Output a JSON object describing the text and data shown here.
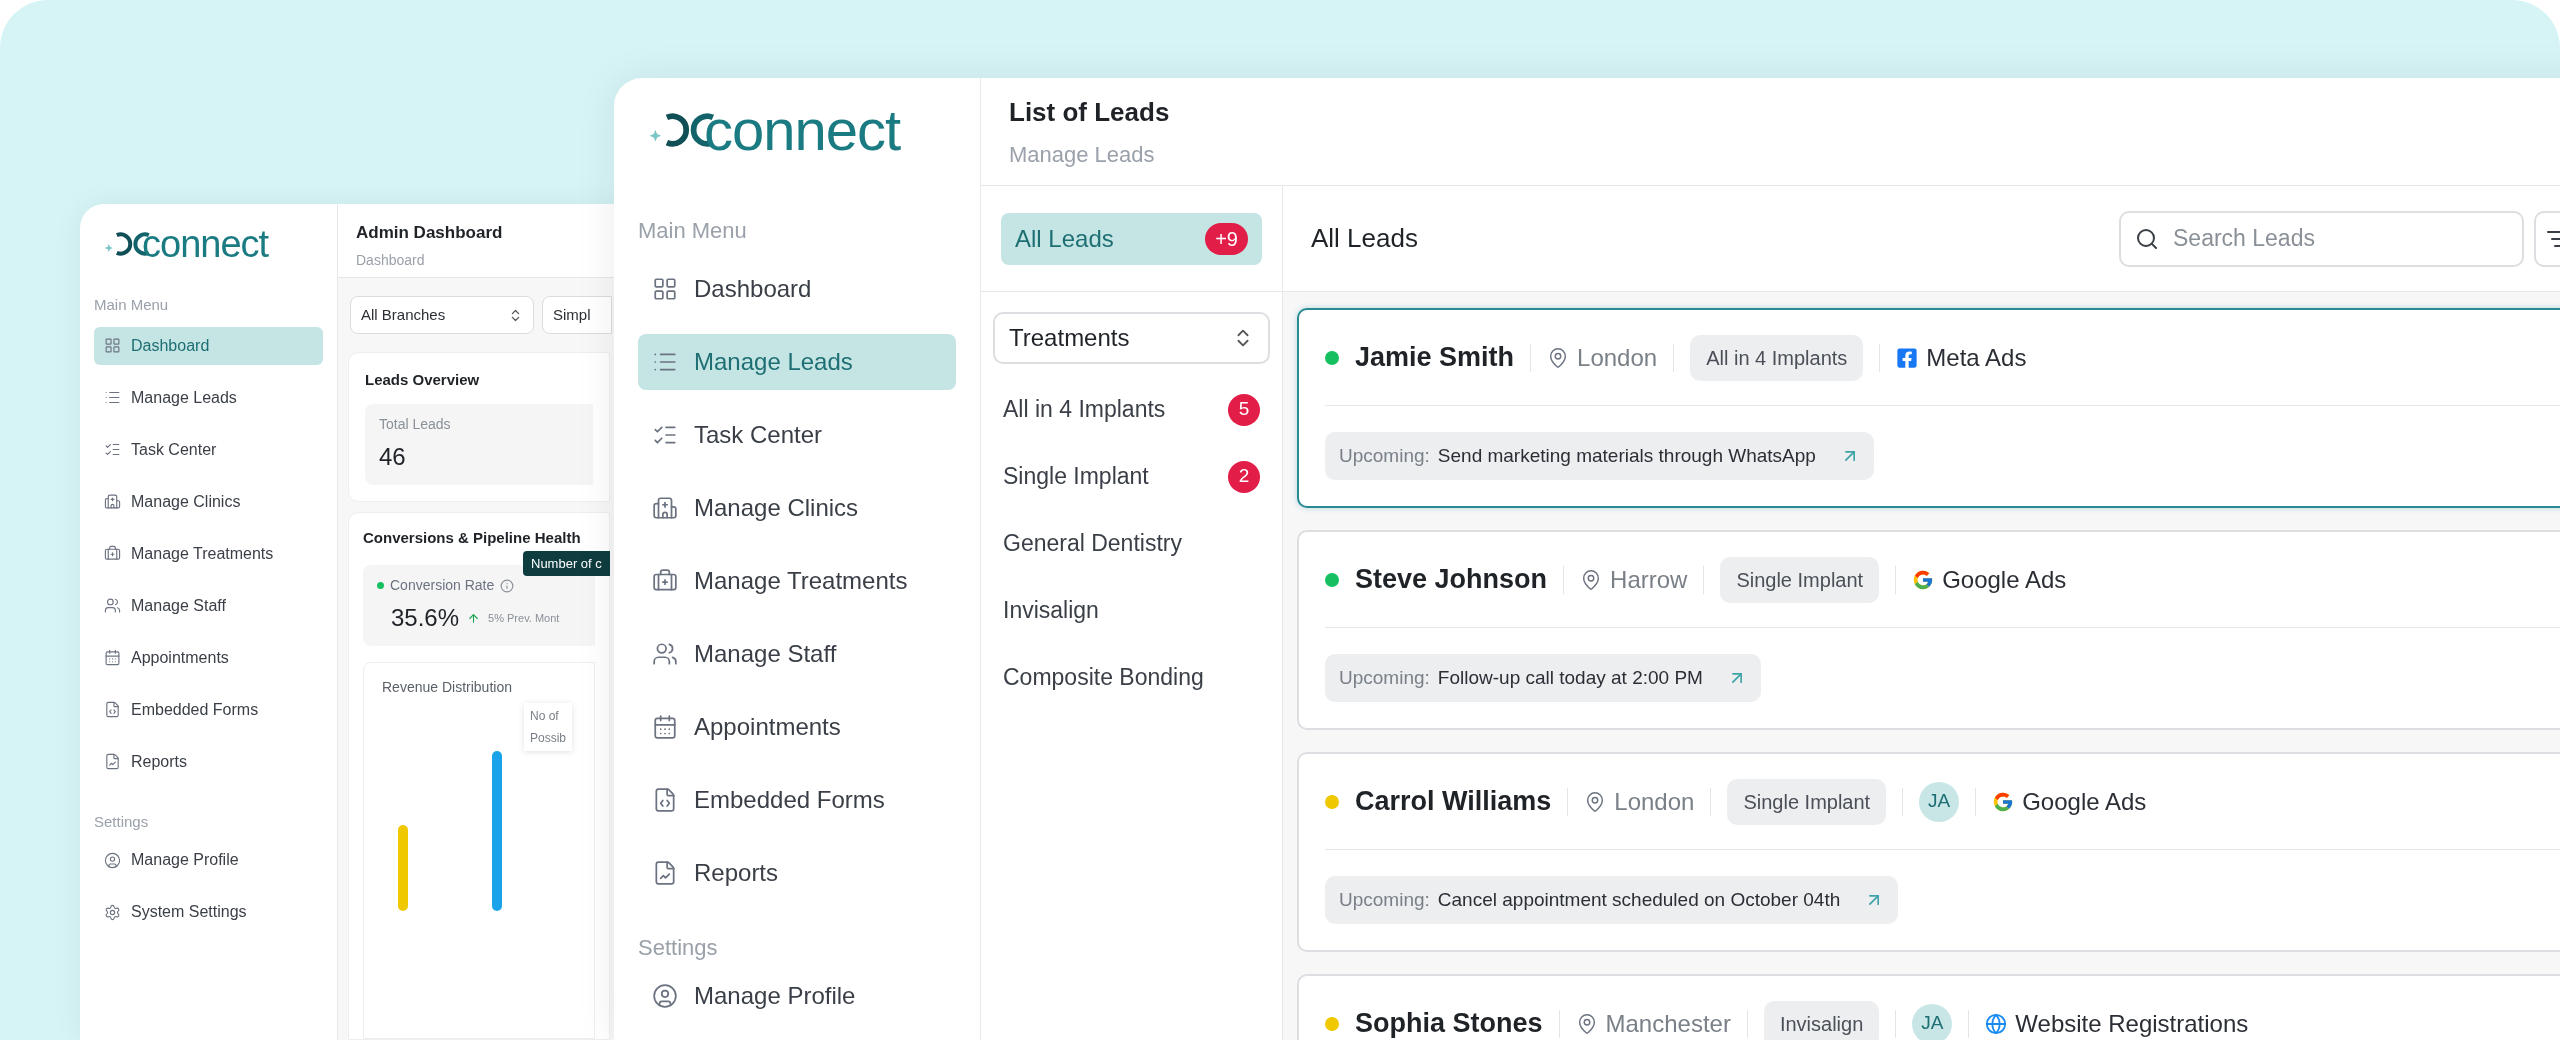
{
  "back_window": {
    "logo": {
      "text": "connect"
    },
    "sidebar": {
      "main_menu_label": "Main Menu",
      "items": [
        {
          "label": "Dashboard",
          "selected": true
        },
        {
          "label": "Manage Leads",
          "selected": false
        },
        {
          "label": "Task Center",
          "selected": false
        },
        {
          "label": "Manage Clinics",
          "selected": false
        },
        {
          "label": "Manage Treatments",
          "selected": false
        },
        {
          "label": "Manage Staff",
          "selected": false
        },
        {
          "label": "Appointments",
          "selected": false
        },
        {
          "label": "Embedded Forms",
          "selected": false
        },
        {
          "label": "Reports",
          "selected": false
        }
      ],
      "settings_label": "Settings",
      "settings_items": [
        {
          "label": "Manage Profile",
          "selected": false
        },
        {
          "label": "System Settings",
          "selected": false
        }
      ]
    },
    "header": {
      "title": "Admin Dashboard",
      "subtitle": "Dashboard"
    },
    "filters": [
      {
        "value": "All Branches"
      },
      {
        "value": "Simpl"
      }
    ],
    "leads_overview": {
      "title": "Leads Overview",
      "stat_label": "Total Leads",
      "stat_value": "46"
    },
    "conversions": {
      "title": "Conversions & Pipeline Health",
      "tooltip": "Number of c",
      "metric_label": "Conversion Rate",
      "metric_value": "35.6%",
      "change": "5% Prev. Mont"
    },
    "revenue": {
      "title": "Revenue Distribution",
      "tooltip_lines": [
        "No of",
        "Possib"
      ]
    }
  },
  "front_window": {
    "logo": {
      "text": "connect"
    },
    "sidebar": {
      "main_menu_label": "Main Menu",
      "items": [
        {
          "label": "Dashboard",
          "selected": false
        },
        {
          "label": "Manage Leads",
          "selected": true
        },
        {
          "label": "Task Center",
          "selected": false
        },
        {
          "label": "Manage Clinics",
          "selected": false
        },
        {
          "label": "Manage Treatments",
          "selected": false
        },
        {
          "label": "Manage Staff",
          "selected": false
        },
        {
          "label": "Appointments",
          "selected": false
        },
        {
          "label": "Embedded Forms",
          "selected": false
        },
        {
          "label": "Reports",
          "selected": false
        }
      ],
      "settings_label": "Settings",
      "settings_items": [
        {
          "label": "Manage Profile",
          "selected": false
        }
      ]
    },
    "header": {
      "title": "List of Leads",
      "subtitle": "Manage Leads"
    },
    "all_leads": {
      "label": "All Leads",
      "badge": "+9",
      "selected": true
    },
    "treatments_select": {
      "value": "Treatments"
    },
    "treatments": [
      {
        "label": "All in 4 Implants",
        "badge": "5",
        "selected": false
      },
      {
        "label": "Single Implant",
        "badge": "2",
        "selected": false
      },
      {
        "label": "General Dentistry",
        "selected": false
      },
      {
        "label": "Invisalign",
        "selected": false
      },
      {
        "label": "Composite Bonding",
        "selected": false
      }
    ],
    "list_title": "All Leads",
    "search": {
      "placeholder": "Search Leads"
    },
    "leads": [
      {
        "name": "Jamie Smith",
        "color": "#16c060",
        "selected": true,
        "city": "London",
        "treatment": "All in 4 Implants",
        "source": {
          "kind": "meta",
          "label": "Meta Ads"
        },
        "upcoming_label": "Upcoming:",
        "upcoming": "Send marketing materials through WhatsApp"
      },
      {
        "name": "Steve Johnson",
        "color": "#16c060",
        "selected": false,
        "city": "Harrow",
        "treatment": "Single Implant",
        "source": {
          "kind": "google",
          "label": "Google Ads"
        },
        "upcoming_label": "Upcoming:",
        "upcoming": "Follow-up call today at 2:00 PM"
      },
      {
        "name": "Carrol Williams",
        "color": "#f0c800",
        "selected": false,
        "city": "London",
        "treatment": "Single Implant",
        "assignee": "JA",
        "source": {
          "kind": "google",
          "label": "Google Ads"
        },
        "upcoming_label": "Upcoming:",
        "upcoming": "Cancel appointment scheduled on October 04th"
      },
      {
        "name": "Sophia Stones",
        "color": "#f0c800",
        "selected": false,
        "city": "Manchester",
        "treatment": "Invisalign",
        "assignee": "JA",
        "source": {
          "kind": "web",
          "label": "Website Registrations"
        }
      }
    ]
  }
}
